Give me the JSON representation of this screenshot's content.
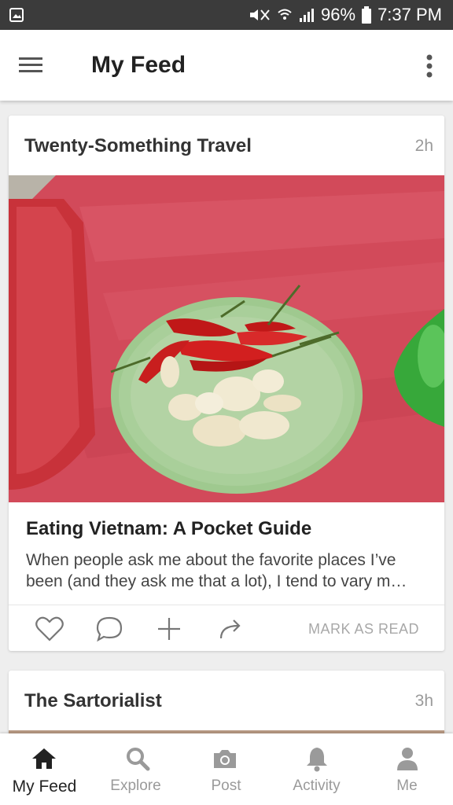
{
  "status_bar": {
    "battery": "96%",
    "time": "7:37 PM",
    "icons": [
      "gallery-notification-icon",
      "mute-icon",
      "wifi-icon",
      "signal-icon",
      "battery-icon"
    ]
  },
  "header": {
    "title": "My Feed",
    "menu_icon": "hamburger-menu-icon",
    "overflow_icon": "more-vert-icon"
  },
  "feed": [
    {
      "source": "Twenty-Something Travel",
      "time": "2h",
      "title": "Eating Vietnam: A Pocket Guide",
      "excerpt": "When people ask me about the favorite places I’ve\nbeen (and they ask me that a lot), I tend to vary m…",
      "actions": [
        "heart-icon",
        "comment-icon",
        "plus-icon",
        "share-icon"
      ],
      "mark_read": "MARK AS READ"
    },
    {
      "source": "The Sartorialist",
      "time": "3h"
    }
  ],
  "bottom_nav": [
    {
      "label": "My Feed",
      "icon": "home-icon",
      "active": true
    },
    {
      "label": "Explore",
      "icon": "search-icon",
      "active": false
    },
    {
      "label": "Post",
      "icon": "camera-icon",
      "active": false
    },
    {
      "label": "Activity",
      "icon": "bell-icon",
      "active": false
    },
    {
      "label": "Me",
      "icon": "person-icon",
      "active": false
    }
  ],
  "colors": {
    "status_bar": "#3b3b3b",
    "background": "#eeeeee",
    "active_nav": "#222222",
    "inactive_nav": "#9a9a9a"
  }
}
